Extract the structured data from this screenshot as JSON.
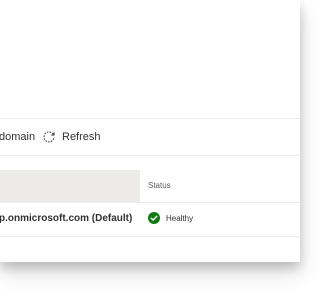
{
  "commands": {
    "domain_label": "domain",
    "refresh_label": "Refresh",
    "refresh_icon": "refresh-icon"
  },
  "table": {
    "columns": [
      "",
      "Status"
    ],
    "rows": [
      {
        "name": "p.onmicrosoft.com (Default)",
        "status": "Healthy",
        "status_icon": "check-circle-icon"
      }
    ]
  },
  "colors": {
    "healthy": "#107c10",
    "header_cell_bg": "#edebe9",
    "divider": "#edebe9"
  }
}
